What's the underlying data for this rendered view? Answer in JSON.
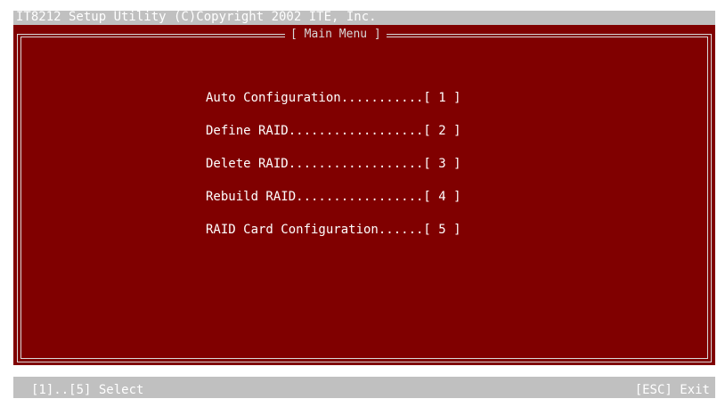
{
  "header": {
    "title": "IT8212 Setup Utility (C)Copyright 2002 ITE, Inc."
  },
  "main_menu": {
    "title": "[ Main Menu ]",
    "items": [
      {
        "label": "Auto Configuration...........[ 1 ]"
      },
      {
        "label": "Define RAID..................[ 2 ]"
      },
      {
        "label": "Delete RAID..................[ 3 ]"
      },
      {
        "label": "Rebuild RAID.................[ 4 ]"
      },
      {
        "label": "RAID Card Configuration......[ 5 ]"
      }
    ]
  },
  "status": {
    "left": "[1]..[5] Select",
    "right": "[ESC] Exit"
  },
  "colors": {
    "background": "#800000",
    "bar": "#c0c0c0",
    "text": "#ffffff"
  }
}
